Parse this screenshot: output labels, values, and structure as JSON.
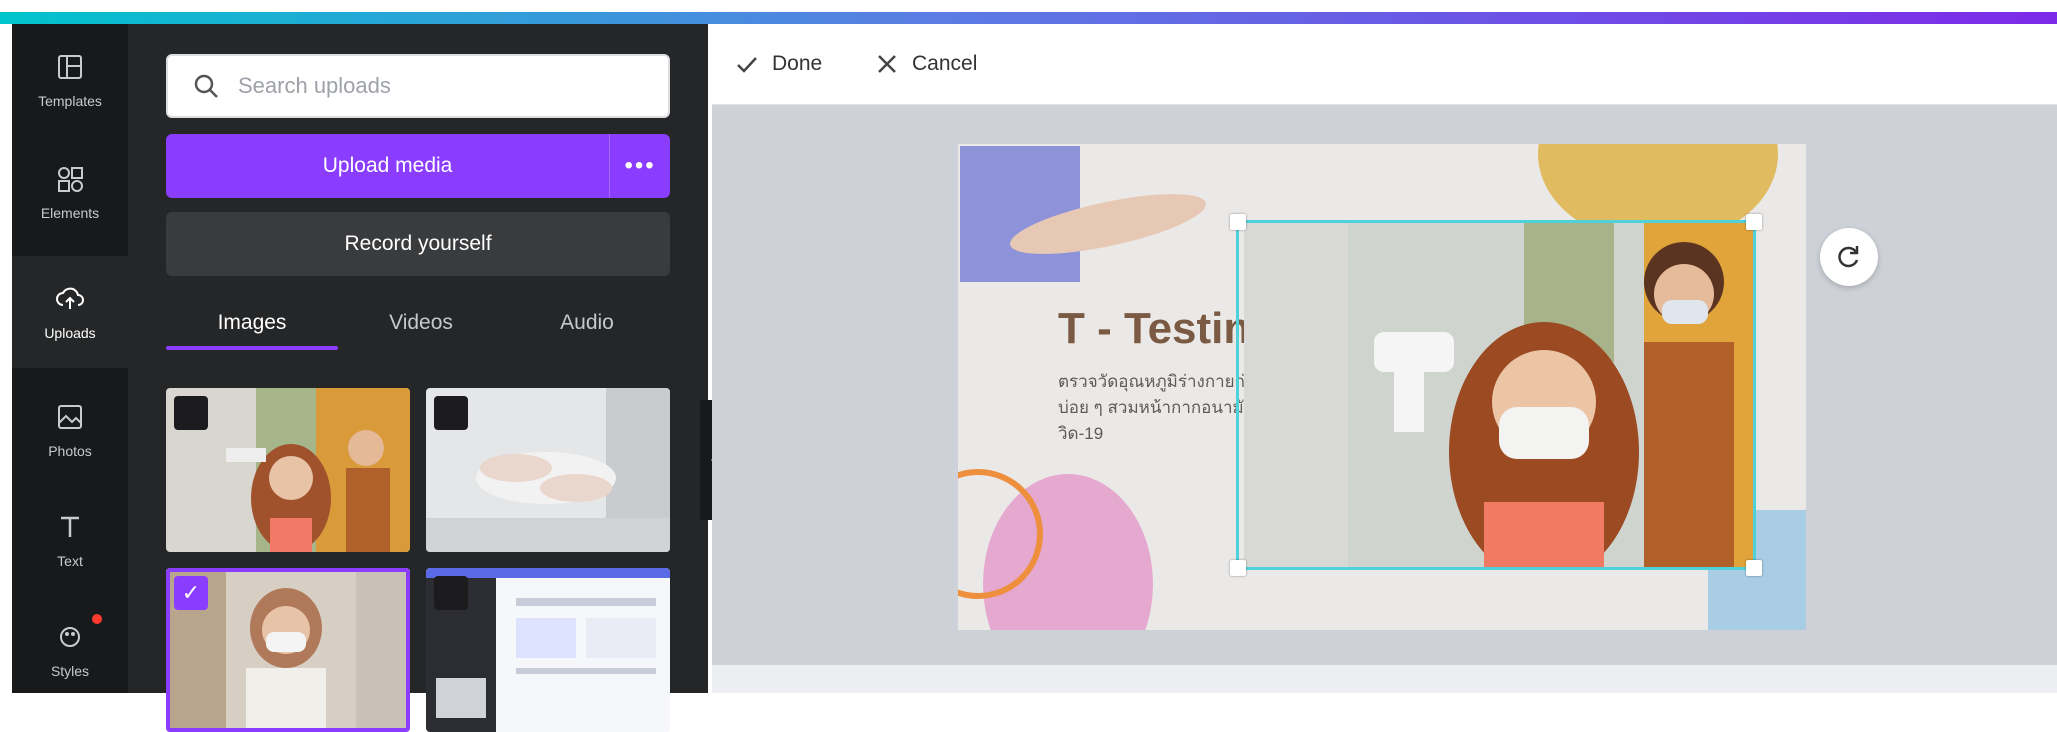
{
  "rail": {
    "items": [
      {
        "label": "Templates",
        "icon": "templates-icon"
      },
      {
        "label": "Elements",
        "icon": "elements-icon"
      },
      {
        "label": "Uploads",
        "icon": "uploads-icon"
      },
      {
        "label": "Photos",
        "icon": "photos-icon"
      },
      {
        "label": "Text",
        "icon": "text-icon"
      },
      {
        "label": "Styles",
        "icon": "styles-icon"
      }
    ]
  },
  "panel": {
    "search_placeholder": "Search uploads",
    "upload_label": "Upload media",
    "upload_more": "•••",
    "record_label": "Record yourself",
    "tabs": [
      {
        "label": "Images"
      },
      {
        "label": "Videos"
      },
      {
        "label": "Audio"
      }
    ]
  },
  "toolbar": {
    "done_label": "Done",
    "cancel_label": "Cancel"
  },
  "slide": {
    "title": "T - Testing",
    "body": "ตรวจวัดอุณหภูมิร่างกายก่อนเข้าพื้นที่ ล้างมือบ่อย ๆ สวมหน้ากากอนามัย เพื่อป้องกันโควิด-19"
  },
  "colors": {
    "accent": "#8b3dff",
    "crop": "#4fd1d9",
    "gradient_start": "#00c4cc",
    "gradient_end": "#7d2ae8"
  }
}
